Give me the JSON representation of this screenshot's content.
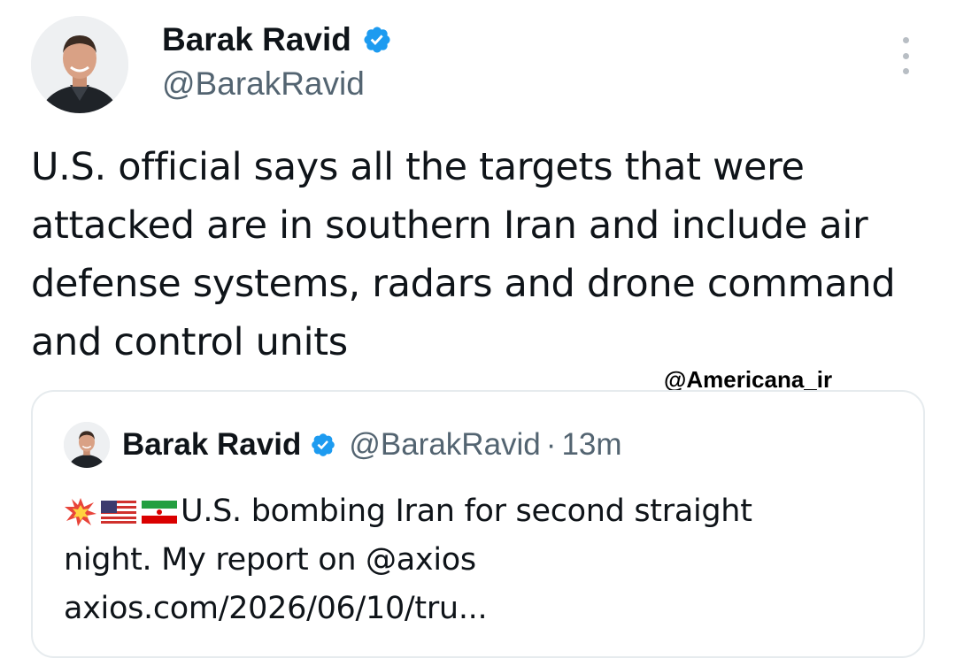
{
  "author": {
    "display_name": "Barak Ravid",
    "handle": "@BarakRavid",
    "verified": true,
    "avatar_icon": "profile-photo"
  },
  "tweet": {
    "text": "U.S. official says all the targets that were attacked are in southern Iran and include air defense systems, radars and drone command and control units"
  },
  "watermark": "@Americana_ir",
  "quoted_tweet": {
    "display_name": "Barak Ravid",
    "handle": "@BarakRavid",
    "separator": "·",
    "time": "13m",
    "emojis": [
      "collision-icon",
      "us-flag-icon",
      "iran-flag-icon"
    ],
    "text_line1": "U.S. bombing Iran for second straight",
    "text_line2": "night. My report on @axios",
    "link": "axios.com/2026/06/10/tru..."
  },
  "colors": {
    "verified_blue": "#1d9bf0",
    "text_primary": "#0f1419",
    "text_secondary": "#536471",
    "card_border": "#e6ebee"
  }
}
